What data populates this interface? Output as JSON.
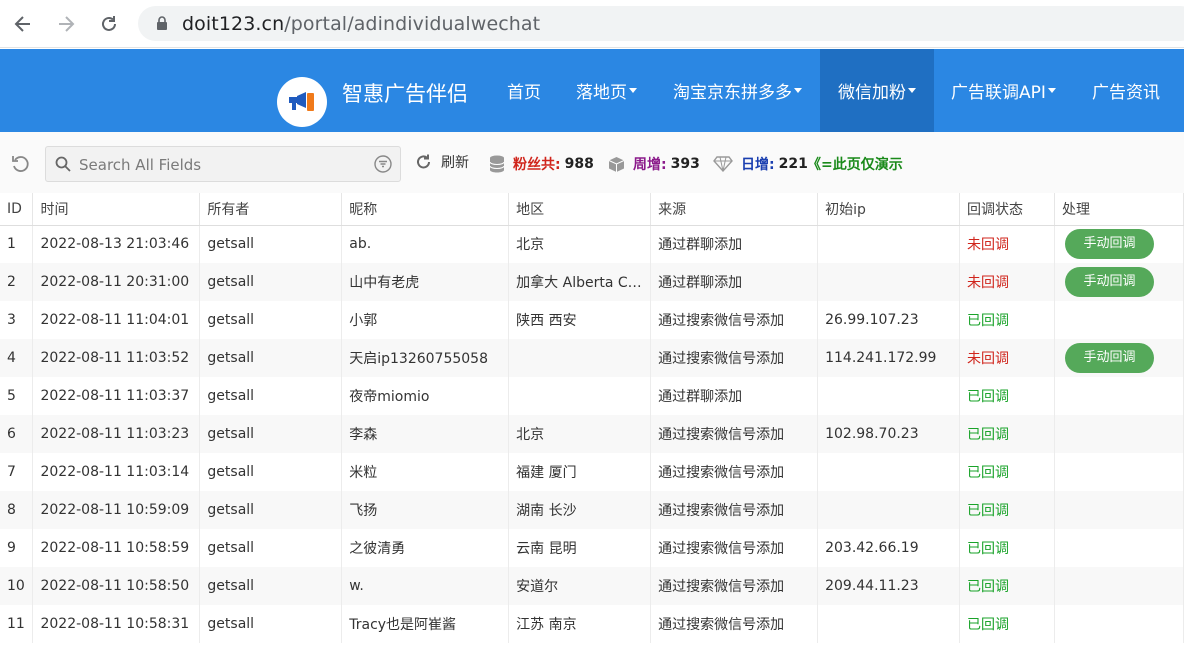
{
  "browser": {
    "url_host": "doit123.cn",
    "url_path": "/portal/adindividualwechat"
  },
  "site": {
    "brand": "智惠广告伴侣",
    "nav": [
      {
        "label": "首页",
        "dropdown": false
      },
      {
        "label": "落地页",
        "dropdown": true
      },
      {
        "label": "淘宝京东拼多多",
        "dropdown": true
      },
      {
        "label": "微信加粉",
        "dropdown": true,
        "active": true
      },
      {
        "label": "广告联调API",
        "dropdown": true
      },
      {
        "label": "广告资讯",
        "dropdown": false
      }
    ]
  },
  "toolbar": {
    "search_placeholder": "Search All Fields",
    "refresh_label": "刷新",
    "fans_label": "粉丝共:",
    "fans_value": "988",
    "week_label": "周增:",
    "week_value": "393",
    "day_label": "日增:",
    "day_value": "221",
    "demo_note": "《=此页仅演示",
    "colors": {
      "fans": "#d0251c",
      "week": "#8b1a8b",
      "day": "#1a3fb0",
      "demo": "#1a8a1a"
    }
  },
  "table": {
    "headers": [
      "ID",
      "时间",
      "所有者",
      "昵称",
      "地区",
      "来源",
      "初始ip",
      "回调状态",
      "处理"
    ],
    "action_label": "手动回调",
    "rows": [
      {
        "id": "1",
        "time": "2022-08-13 21:03:46",
        "owner": "getsall",
        "nick": "ab.",
        "region": "北京",
        "source": "通过群聊添加",
        "ip": "",
        "status": "未回调",
        "action": true
      },
      {
        "id": "2",
        "time": "2022-08-11 20:31:00",
        "owner": "getsall",
        "nick": "山中有老虎",
        "region": "加拿大 Alberta Ca...",
        "source": "通过群聊添加",
        "ip": "",
        "status": "未回调",
        "action": true
      },
      {
        "id": "3",
        "time": "2022-08-11 11:04:01",
        "owner": "getsall",
        "nick": "小郭",
        "region": "陕西 西安",
        "source": "通过搜索微信号添加",
        "ip": "26.99.107.23",
        "status": "已回调",
        "action": false
      },
      {
        "id": "4",
        "time": "2022-08-11 11:03:52",
        "owner": "getsall",
        "nick": "天启ip13260755058",
        "region": "",
        "source": "通过搜索微信号添加",
        "ip": "114.241.172.99",
        "status": "未回调",
        "action": true
      },
      {
        "id": "5",
        "time": "2022-08-11 11:03:37",
        "owner": "getsall",
        "nick": "夜帝miomio",
        "region": "",
        "source": "通过群聊添加",
        "ip": "",
        "status": "已回调",
        "action": false
      },
      {
        "id": "6",
        "time": "2022-08-11 11:03:23",
        "owner": "getsall",
        "nick": "李森",
        "region": "北京",
        "source": "通过搜索微信号添加",
        "ip": "102.98.70.23",
        "status": "已回调",
        "action": false
      },
      {
        "id": "7",
        "time": "2022-08-11 11:03:14",
        "owner": "getsall",
        "nick": "米粒",
        "region": "福建 厦门",
        "source": "通过搜索微信号添加",
        "ip": "",
        "status": "已回调",
        "action": false
      },
      {
        "id": "8",
        "time": "2022-08-11 10:59:09",
        "owner": "getsall",
        "nick": "飞扬",
        "region": "湖南 长沙",
        "source": "通过搜索微信号添加",
        "ip": "",
        "status": "已回调",
        "action": false
      },
      {
        "id": "9",
        "time": "2022-08-11 10:58:59",
        "owner": "getsall",
        "nick": "之彼清勇",
        "region": "云南 昆明",
        "source": "通过搜索微信号添加",
        "ip": "203.42.66.19",
        "status": "已回调",
        "action": false
      },
      {
        "id": "10",
        "time": "2022-08-11 10:58:50",
        "owner": "getsall",
        "nick": "w.",
        "region": "安道尔",
        "source": "通过搜索微信号添加",
        "ip": "209.44.11.23",
        "status": "已回调",
        "action": false
      },
      {
        "id": "11",
        "time": "2022-08-11 10:58:31",
        "owner": "getsall",
        "nick": "Tracy也是阿崔酱",
        "region": "江苏 南京",
        "source": "通过搜索微信号添加",
        "ip": "",
        "status": "已回调",
        "action": false
      }
    ]
  }
}
